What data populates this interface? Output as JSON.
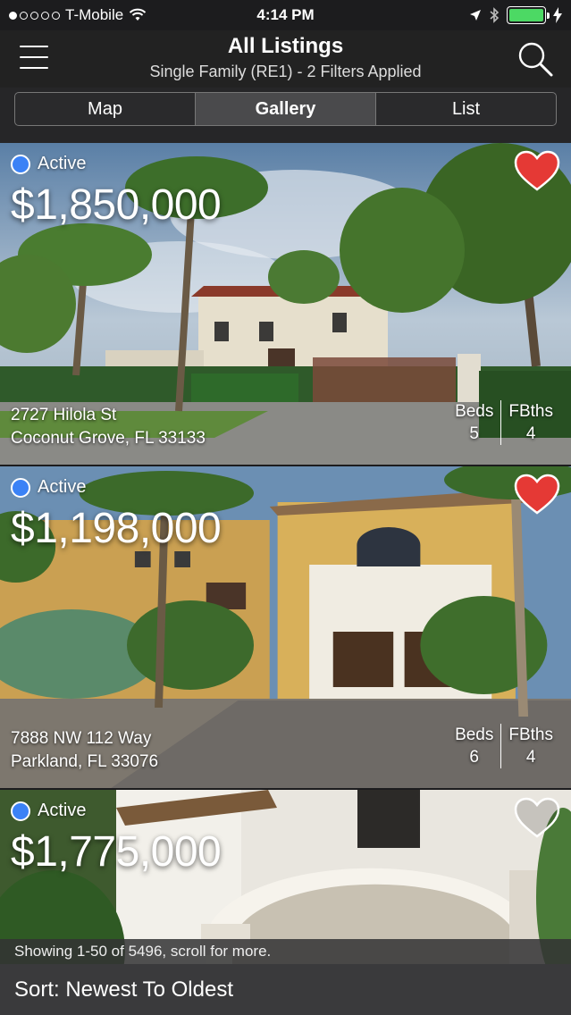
{
  "status_bar": {
    "carrier": "T-Mobile",
    "time": "4:14 PM",
    "battery_color": "#4cd964"
  },
  "nav": {
    "title": "All Listings",
    "subtitle": "Single Family (RE1) - 2 Filters Applied",
    "menu_icon": "hamburger-menu-icon",
    "search_icon": "search-icon"
  },
  "view_tabs": {
    "map": "Map",
    "gallery": "Gallery",
    "list": "List",
    "selected": "Gallery"
  },
  "listings": [
    {
      "status": "Active",
      "price": "$1,850,000",
      "street": "2727 Hilola St",
      "city": "Coconut Grove, FL 33133",
      "beds_label": "Beds",
      "beds": "5",
      "baths_label": "FBths",
      "baths": "4",
      "favorited": true
    },
    {
      "status": "Active",
      "price": "$1,198,000",
      "street": "7888 NW 112 Way",
      "city": "Parkland, FL 33076",
      "beds_label": "Beds",
      "beds": "6",
      "baths_label": "FBths",
      "baths": "4",
      "favorited": true
    },
    {
      "status": "Active",
      "price": "$1,775,000",
      "favorited": false
    }
  ],
  "footer": {
    "showing": "Showing 1-50 of 5496, scroll for more.",
    "sort": "Sort: Newest To Oldest"
  },
  "colors": {
    "active_dot": "#3b82f6",
    "heart_fill": "#e53935"
  }
}
